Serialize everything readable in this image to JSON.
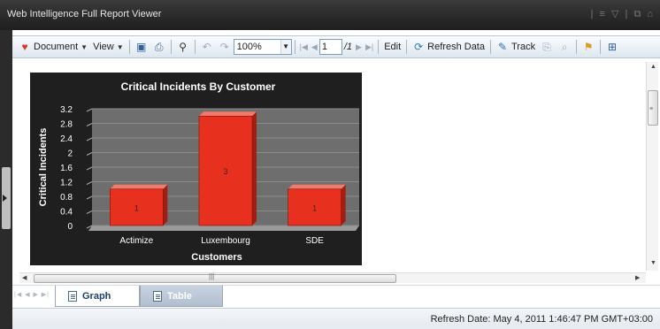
{
  "window": {
    "title": "Web Intelligence Full Report Viewer"
  },
  "toolbar": {
    "document_label": "Document",
    "view_label": "View",
    "zoom_value": "100%",
    "page_value": "1",
    "page_total": "/1",
    "edit_label": "Edit",
    "refresh_label": "Refresh Data",
    "track_label": "Track"
  },
  "tabs": [
    {
      "label": "Graph",
      "active": true
    },
    {
      "label": "Table",
      "active": false
    }
  ],
  "status": {
    "text": "Refresh Date: May 4, 2011 1:46:47 PM GMT+03:00"
  },
  "chart_data": {
    "type": "bar",
    "title": "Critical Incidents By Customer",
    "xlabel": "Customers",
    "ylabel": "Critical Incidents",
    "categories": [
      "Actimize",
      "Luxembourg",
      "SDE"
    ],
    "values": [
      1,
      3,
      1
    ],
    "data_labels": [
      "1",
      "3",
      "1"
    ],
    "ylim": [
      0,
      3.2
    ],
    "yticks": [
      "0",
      "0.4",
      "0.8",
      "1.2",
      "1.6",
      "2",
      "2.4",
      "2.8",
      "3.2"
    ],
    "grid": true,
    "bar_color": "#e8301f",
    "background": "#1f1f1f",
    "plot_background": "#6e6e6e"
  }
}
